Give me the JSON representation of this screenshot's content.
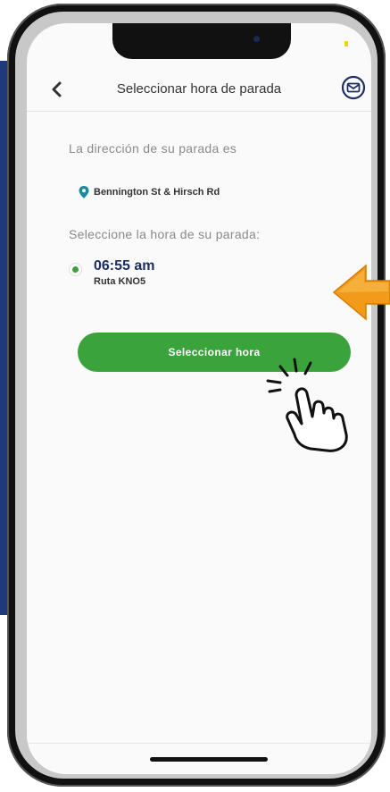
{
  "nav": {
    "title": "Seleccionar hora de parada"
  },
  "content": {
    "address_label": "La dirección de su parada es",
    "address": "Bennington St & Hirsch Rd",
    "select_label": "Seleccione la hora de su parada:",
    "option": {
      "time": "06:55 am",
      "route": "Ruta KNO5",
      "selected": true
    },
    "button_label": "Seleccionar hora"
  },
  "colors": {
    "accent_green": "#3aa33b",
    "time_blue": "#1b2f66",
    "pin_teal": "#1a8a9a",
    "arrow_orange": "#f29a1a"
  },
  "icons": [
    "back-chevron-icon",
    "mail-icon",
    "location-pin-icon",
    "arrow-pointer-icon",
    "hand-tap-icon"
  ]
}
